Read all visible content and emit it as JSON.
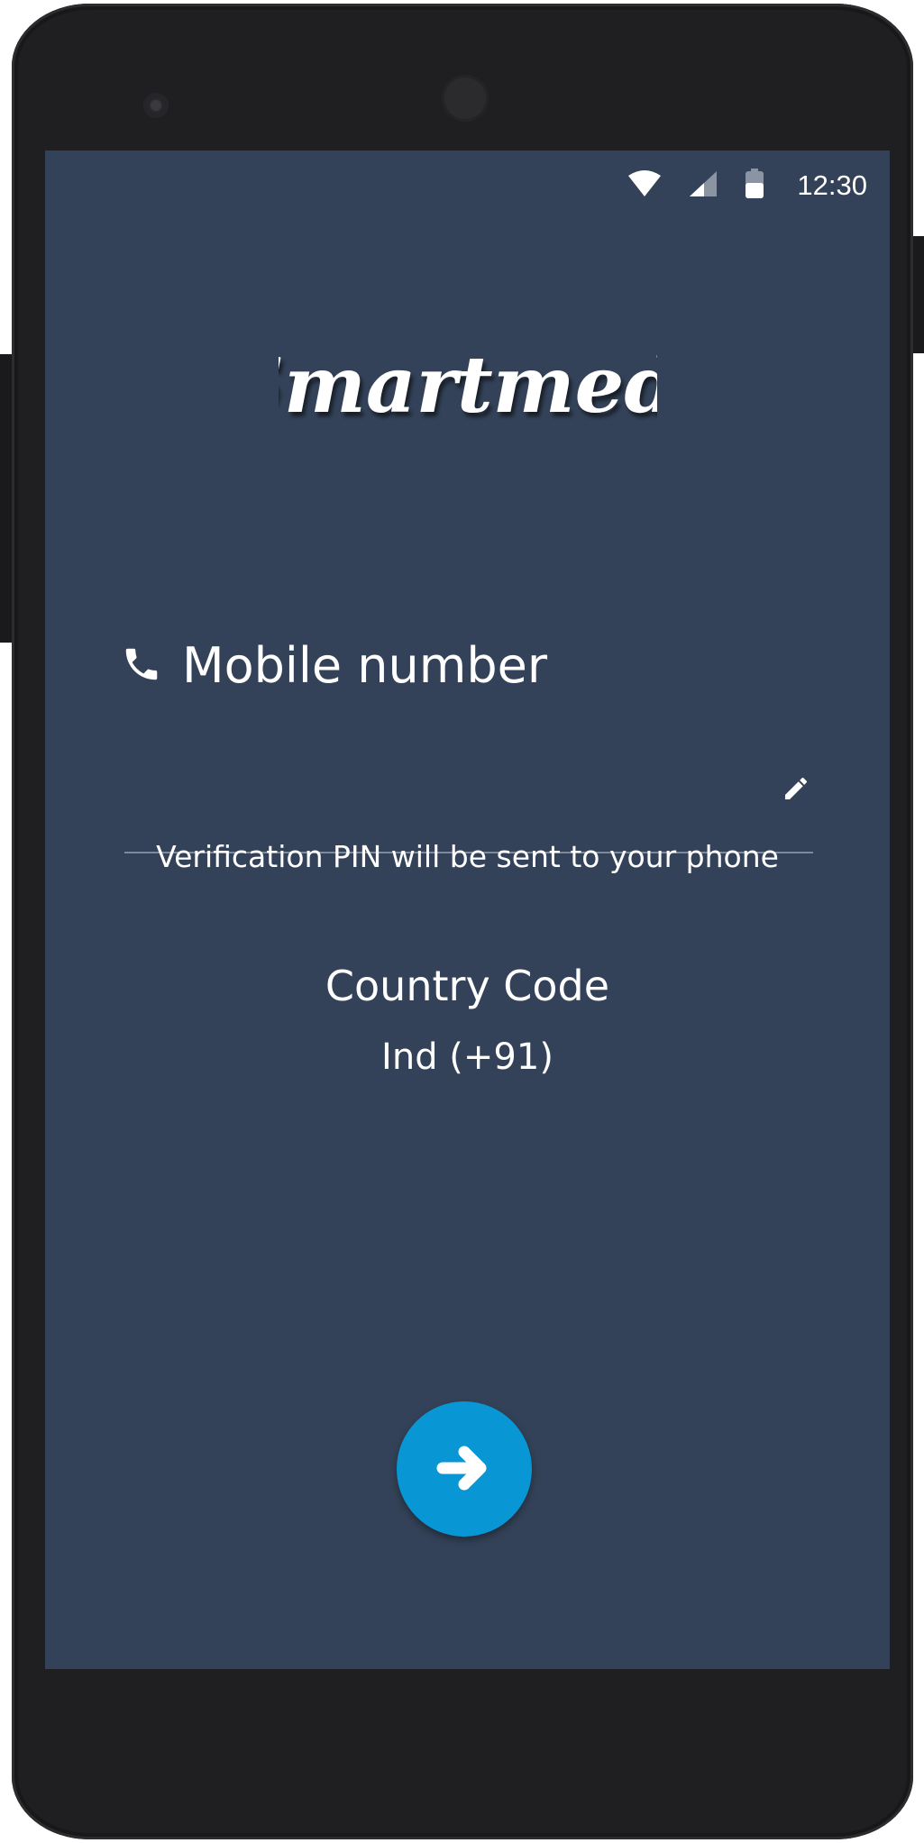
{
  "status_bar": {
    "time": "12:30",
    "icons": [
      "wifi-icon",
      "signal-icon",
      "battery-icon"
    ]
  },
  "app": {
    "logo_text": "Smartmedi"
  },
  "form": {
    "mobile_label": "Mobile number",
    "mobile_icon": "phone-icon",
    "mobile_value": "",
    "edit_icon": "pencil-icon",
    "helper_text": "Verification PIN will be sent to your phone",
    "country_code_title": "Country Code",
    "country_code_value": "Ind (+91)"
  },
  "actions": {
    "next_icon": "arrow-right-icon"
  },
  "colors": {
    "background": "#334258",
    "accent": "#0996d4",
    "text": "#ffffff",
    "phone_body": "#1f1f21"
  }
}
